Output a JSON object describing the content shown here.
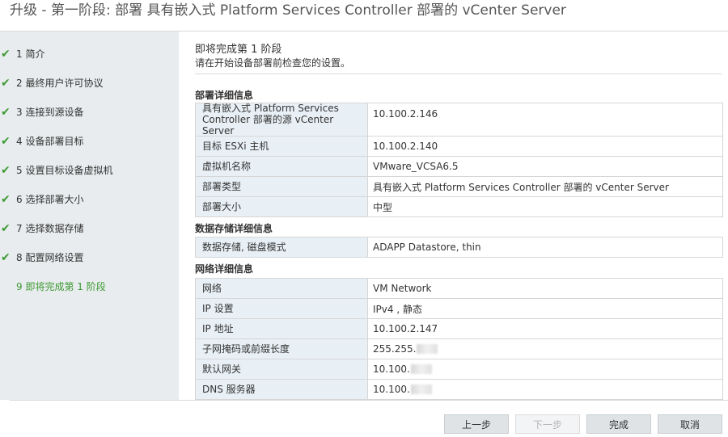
{
  "window": {
    "title": "升级 - 第一阶段: 部署 具有嵌入式 Platform Services Controller 部署的 vCenter Server"
  },
  "steps": [
    {
      "label": "1 简介",
      "done": true
    },
    {
      "label": "2 最终用户许可协议",
      "done": true
    },
    {
      "label": "3 连接到源设备",
      "done": true
    },
    {
      "label": "4 设备部署目标",
      "done": true
    },
    {
      "label": "5 设置目标设备虚拟机",
      "done": true
    },
    {
      "label": "6 选择部署大小",
      "done": true
    },
    {
      "label": "7 选择数据存储",
      "done": true
    },
    {
      "label": "8 配置网络设置",
      "done": true
    },
    {
      "label": "9 即将完成第 1 阶段",
      "done": false,
      "active": true
    }
  ],
  "main": {
    "heading": "即将完成第 1 阶段",
    "subheading": "请在开始设备部署前检查您的设置。"
  },
  "deploy_section": {
    "title": "部署详细信息",
    "rows": [
      {
        "key": "具有嵌入式 Platform Services Controller 部署的源 vCenter Server",
        "value": "10.100.2.146"
      },
      {
        "key": "目标 ESXi 主机",
        "value": "10.100.2.140"
      },
      {
        "key": "虚拟机名称",
        "value": "VMware_VCSA6.5"
      },
      {
        "key": "部署类型",
        "value": "具有嵌入式 Platform Services Controller 部署的 vCenter Server"
      },
      {
        "key": "部署大小",
        "value": "中型"
      }
    ]
  },
  "storage_section": {
    "title": "数据存储详细信息",
    "rows": [
      {
        "key": "数据存储, 磁盘模式",
        "value": "ADAPP Datastore, thin"
      }
    ]
  },
  "network_section": {
    "title": "网络详细信息",
    "rows": [
      {
        "key": "网络",
        "value": "VM Network"
      },
      {
        "key": "IP 设置",
        "value": "IPv4 , 静态"
      },
      {
        "key": "IP 地址",
        "value": "10.100.2.147"
      },
      {
        "key": "子网掩码或前缀长度",
        "value": "255.255."
      },
      {
        "key": "默认网关",
        "value": "10.100."
      },
      {
        "key": "DNS 服务器",
        "value": "10.100."
      }
    ]
  },
  "buttons": {
    "back": "上一步",
    "next": "下一步",
    "finish": "完成",
    "cancel": "取消"
  },
  "colors": {
    "accent_green": "#3f9a35",
    "sidebar_bg": "#e8ecee",
    "key_cell_bg": "#e8f0f6"
  },
  "icons": {
    "step_done": "check-icon"
  }
}
